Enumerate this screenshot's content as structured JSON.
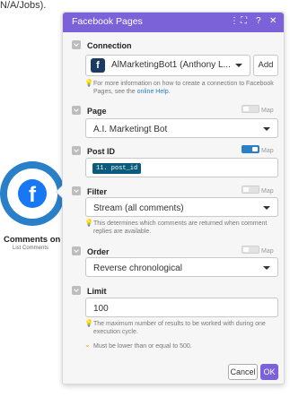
{
  "canvas": {
    "top_fragment": "N/A/Jobs).",
    "module": {
      "name": "Comments on Po",
      "subtitle": "List Comments"
    }
  },
  "panel": {
    "title": "Facebook Pages",
    "header_icons": [
      "more-icon",
      "expand-icon",
      "help-icon",
      "close-icon"
    ],
    "header_glyphs": {
      "more": "⋮",
      "expand": "⛶",
      "help": "?",
      "close": "✕"
    },
    "connection": {
      "label": "Connection",
      "value": "AlMarketingBot1 (Anthony L...",
      "add_label": "Add",
      "hint_line1": "For more information on how to create a connection to Facebook",
      "hint_line2_prefix": "Pages, see the ",
      "hint_link": "online Help",
      "hint_suffix": "."
    },
    "page": {
      "label": "Page",
      "map_label": "Map",
      "value": "A.I. Marketingt Bot"
    },
    "post_id": {
      "label": "Post ID",
      "map_label": "Map",
      "token": "11. post_id"
    },
    "filter": {
      "label": "Filter",
      "map_label": "Map",
      "value": "Stream (all comments)",
      "hint_line1": "This determines which comments are returned when comment",
      "hint_line2": "replies are available."
    },
    "order": {
      "label": "Order",
      "map_label": "Map",
      "value": "Reverse chronological"
    },
    "limit": {
      "label": "Limit",
      "value": "100",
      "hint_line1": "The maximum number of results to be worked with during one",
      "hint_line2": "execution cycle.",
      "validation": "Must be lower than or equal to 500."
    },
    "footer": {
      "cancel_label": "Cancel",
      "ok_label": "OK"
    }
  },
  "colors": {
    "header": "#7b62d9",
    "toggle_on": "#2a7fc9",
    "token_bg": "#0b5c7c",
    "hint_icon": "#f0b400",
    "module_ring": "#2a7fc9"
  }
}
